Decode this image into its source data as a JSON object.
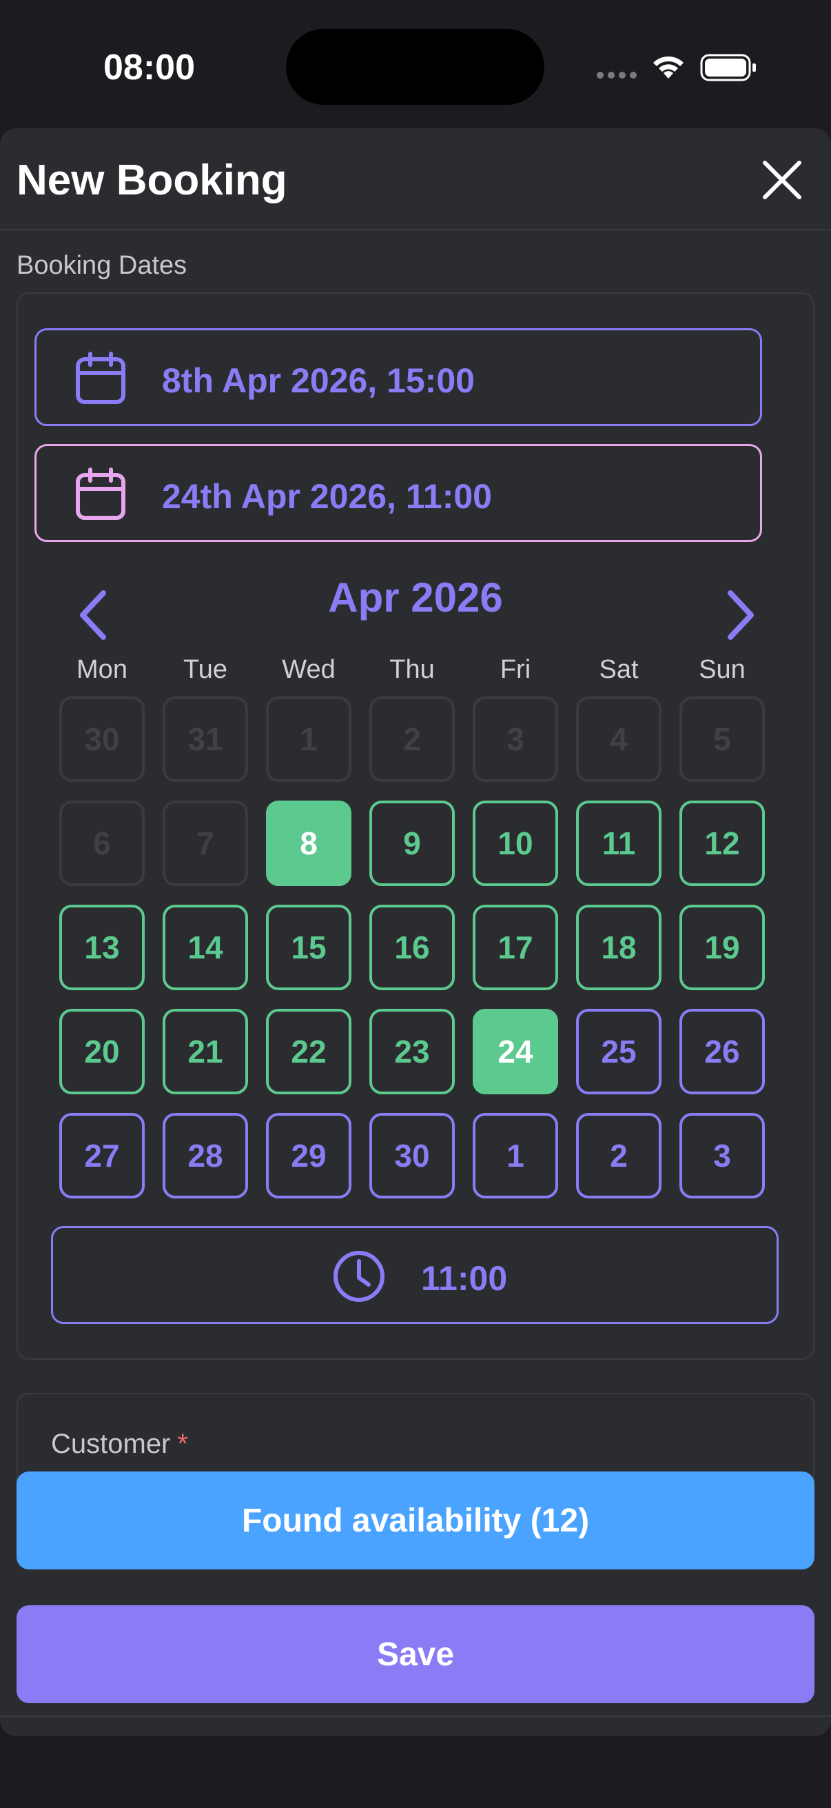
{
  "status_bar": {
    "time": "08:00"
  },
  "header": {
    "title": "New Booking"
  },
  "booking_dates": {
    "label": "Booking Dates",
    "start": "8th Apr 2026, 15:00",
    "end": "24th Apr 2026, 11:00"
  },
  "calendar": {
    "month": "Apr 2026",
    "weekdays": [
      "Mon",
      "Tue",
      "Wed",
      "Thu",
      "Fri",
      "Sat",
      "Sun"
    ],
    "weeks": [
      [
        {
          "label": "30",
          "state": "disabled"
        },
        {
          "label": "31",
          "state": "disabled"
        },
        {
          "label": "1",
          "state": "disabled"
        },
        {
          "label": "2",
          "state": "disabled"
        },
        {
          "label": "3",
          "state": "disabled"
        },
        {
          "label": "4",
          "state": "disabled"
        },
        {
          "label": "5",
          "state": "disabled"
        }
      ],
      [
        {
          "label": "6",
          "state": "disabled"
        },
        {
          "label": "7",
          "state": "disabled"
        },
        {
          "label": "8",
          "state": "selected"
        },
        {
          "label": "9",
          "state": "in-range"
        },
        {
          "label": "10",
          "state": "in-range"
        },
        {
          "label": "11",
          "state": "in-range"
        },
        {
          "label": "12",
          "state": "in-range"
        }
      ],
      [
        {
          "label": "13",
          "state": "in-range"
        },
        {
          "label": "14",
          "state": "in-range"
        },
        {
          "label": "15",
          "state": "in-range"
        },
        {
          "label": "16",
          "state": "in-range"
        },
        {
          "label": "17",
          "state": "in-range"
        },
        {
          "label": "18",
          "state": "in-range"
        },
        {
          "label": "19",
          "state": "in-range"
        }
      ],
      [
        {
          "label": "20",
          "state": "in-range"
        },
        {
          "label": "21",
          "state": "in-range"
        },
        {
          "label": "22",
          "state": "in-range"
        },
        {
          "label": "23",
          "state": "in-range"
        },
        {
          "label": "24",
          "state": "selected"
        },
        {
          "label": "25",
          "state": "available"
        },
        {
          "label": "26",
          "state": "available"
        }
      ],
      [
        {
          "label": "27",
          "state": "available"
        },
        {
          "label": "28",
          "state": "available"
        },
        {
          "label": "29",
          "state": "available"
        },
        {
          "label": "30",
          "state": "available"
        },
        {
          "label": "1",
          "state": "available"
        },
        {
          "label": "2",
          "state": "available"
        },
        {
          "label": "3",
          "state": "available"
        }
      ]
    ],
    "time": "11:00"
  },
  "customer": {
    "label": "Customer",
    "required_mark": "*"
  },
  "actions": {
    "availability_label": "Found availability (12)",
    "save_label": "Save"
  },
  "colors": {
    "accent": "#8b7cf6",
    "range_green": "#5cc98f",
    "end_pink": "#e8a6ef",
    "availability_blue": "#4aa3ff",
    "required_red": "#ef6b6b"
  },
  "icons": {
    "close": "close-icon",
    "start_calendar": "calendar-icon",
    "end_calendar": "calendar-icon",
    "prev": "chevron-left-icon",
    "next": "chevron-right-icon",
    "time": "clock-icon"
  }
}
